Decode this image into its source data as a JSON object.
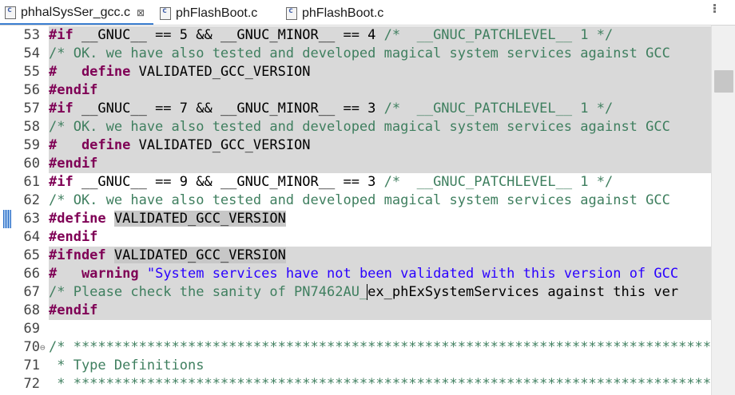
{
  "tabs": [
    {
      "label": "phhalSysSer_gcc.c",
      "active": true,
      "close": "⊠"
    },
    {
      "label": "phFlashBoot.c",
      "active": false
    },
    {
      "label": "phFlashBoot.c",
      "active": false
    }
  ],
  "editor": {
    "lines": [
      {
        "num": "53",
        "hl": true,
        "parts": [
          {
            "k": "pp",
            "t": "#if"
          },
          {
            "k": "tx",
            "t": " __GNUC__ == 5 && __GNUC_MINOR__ == 4 "
          },
          {
            "k": "cm",
            "t": "/*  __GNUC_PATCHLEVEL__ 1 */"
          }
        ]
      },
      {
        "num": "54",
        "hl": true,
        "parts": [
          {
            "k": "cm",
            "t": "/* OK. we have also tested and developed magical system services against GCC"
          }
        ]
      },
      {
        "num": "55",
        "hl": true,
        "parts": [
          {
            "k": "pp",
            "t": "#   define"
          },
          {
            "k": "tx",
            "t": " VALIDATED_GCC_VERSION"
          }
        ]
      },
      {
        "num": "56",
        "hl": true,
        "parts": [
          {
            "k": "pp",
            "t": "#endif"
          }
        ]
      },
      {
        "num": "57",
        "hl": true,
        "parts": [
          {
            "k": "pp",
            "t": "#if"
          },
          {
            "k": "tx",
            "t": " __GNUC__ == 7 && __GNUC_MINOR__ == 3 "
          },
          {
            "k": "cm",
            "t": "/*  __GNUC_PATCHLEVEL__ 1 */"
          }
        ]
      },
      {
        "num": "58",
        "hl": true,
        "parts": [
          {
            "k": "cm",
            "t": "/* OK. we have also tested and developed magical system services against GCC"
          }
        ]
      },
      {
        "num": "59",
        "hl": true,
        "parts": [
          {
            "k": "pp",
            "t": "#   define"
          },
          {
            "k": "tx",
            "t": " VALIDATED_GCC_VERSION"
          }
        ]
      },
      {
        "num": "60",
        "hl": true,
        "parts": [
          {
            "k": "pp",
            "t": "#endif"
          }
        ]
      },
      {
        "num": "61",
        "hl": false,
        "parts": [
          {
            "k": "pp",
            "t": "#if"
          },
          {
            "k": "tx",
            "t": " __GNUC__ == 9 && __GNUC_MINOR__ == 3 "
          },
          {
            "k": "cm",
            "t": "/*  __GNUC_PATCHLEVEL__ 1 */"
          }
        ]
      },
      {
        "num": "62",
        "hl": false,
        "parts": [
          {
            "k": "cm",
            "t": "/* OK. we have also tested and developed magical system services against GCC"
          }
        ]
      },
      {
        "num": "63",
        "hl": false,
        "marker": true,
        "parts": [
          {
            "k": "pp",
            "t": "#define"
          },
          {
            "k": "tx",
            "t": " "
          },
          {
            "k": "mark",
            "t": "VALIDATED_GCC_VERSION"
          }
        ]
      },
      {
        "num": "64",
        "hl": false,
        "parts": [
          {
            "k": "pp",
            "t": "#endif"
          }
        ]
      },
      {
        "num": "65",
        "hl": true,
        "parts": [
          {
            "k": "pp",
            "t": "#ifndef"
          },
          {
            "k": "tx",
            "t": " "
          },
          {
            "k": "mark",
            "t": "VALIDATED_GCC_VERSION"
          }
        ]
      },
      {
        "num": "66",
        "hl": true,
        "parts": [
          {
            "k": "pp",
            "t": "#   warning"
          },
          {
            "k": "tx",
            "t": " "
          },
          {
            "k": "st",
            "t": "\"System services have not been validated with this version of GCC"
          }
        ]
      },
      {
        "num": "67",
        "hl": true,
        "parts": [
          {
            "k": "cm",
            "t": "/* Please check the sanity of PN7462AU_"
          },
          {
            "k": "caret",
            "t": "ex_phExSystemServices against this ver"
          }
        ]
      },
      {
        "num": "68",
        "hl": true,
        "parts": [
          {
            "k": "pp",
            "t": "#endif"
          }
        ]
      },
      {
        "num": "69",
        "hl": false,
        "parts": []
      },
      {
        "num": "70",
        "hl": false,
        "fold": "⊖",
        "parts": [
          {
            "k": "cm",
            "t": "/* ******************************************************************************"
          }
        ]
      },
      {
        "num": "71",
        "hl": false,
        "parts": [
          {
            "k": "cm",
            "t": " * Type Definitions"
          }
        ]
      },
      {
        "num": "72",
        "hl": false,
        "parts": [
          {
            "k": "cm",
            "t": " * ******************************************************************************"
          }
        ]
      }
    ]
  }
}
